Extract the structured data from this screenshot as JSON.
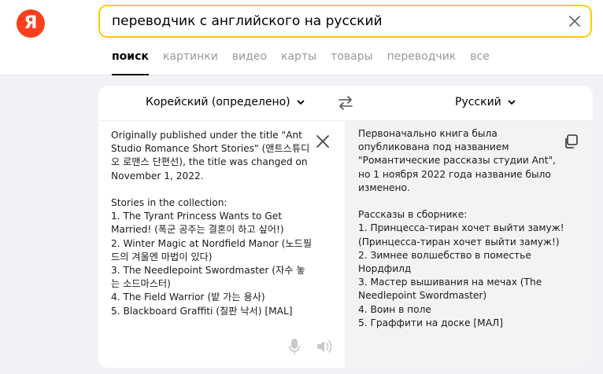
{
  "logo": {
    "letter": "Я"
  },
  "search": {
    "query": "переводчик с английского на русский"
  },
  "tabs": [
    {
      "label": "поиск",
      "active": true
    },
    {
      "label": "картинки"
    },
    {
      "label": "видео"
    },
    {
      "label": "карты"
    },
    {
      "label": "товары"
    },
    {
      "label": "переводчик"
    },
    {
      "label": "все"
    }
  ],
  "translator": {
    "source_lang": "Корейский (определено)",
    "target_lang": "Русский",
    "source_text": "Originally published under the title \"Ant Studio Romance Short Stories\" (앤트스튜디오 로맨스 단편선), the title was changed on November 1, 2022.\n\nStories in the collection:\n1. The Tyrant Princess Wants to Get Married! (폭군 공주는 결혼이 하고 싶어!)\n2. Winter Magic at Nordfield Manor (노드필드의 겨울엔 마법이 있다)\n3. The Needlepoint Swordmaster (자수 놓는 소드마스터)\n4. The Field Warrior (밭 가는 용사)\n5. Blackboard Graffiti (칠판 낙서) [MAL]",
    "target_text": "Первоначально книга была опубликована под названием \"Романтические рассказы студии Ant\", но 1 ноября 2022 года название было изменено.\n\nРассказы в сборнике:\n1. Принцесса-тиран хочет выйти замуж! (Принцесса-тиран хочет выйти замуж!)\n2. Зимнее волшебство в поместье Нордфилд\n3. Мастер вышивания на мечах (The Needlepoint Swordmaster)\n4. Воин в поле\n5. Граффити на доске [МАЛ]"
  },
  "colors": {
    "brand": "#fc3f1d",
    "search_border": "#ffcc00"
  }
}
